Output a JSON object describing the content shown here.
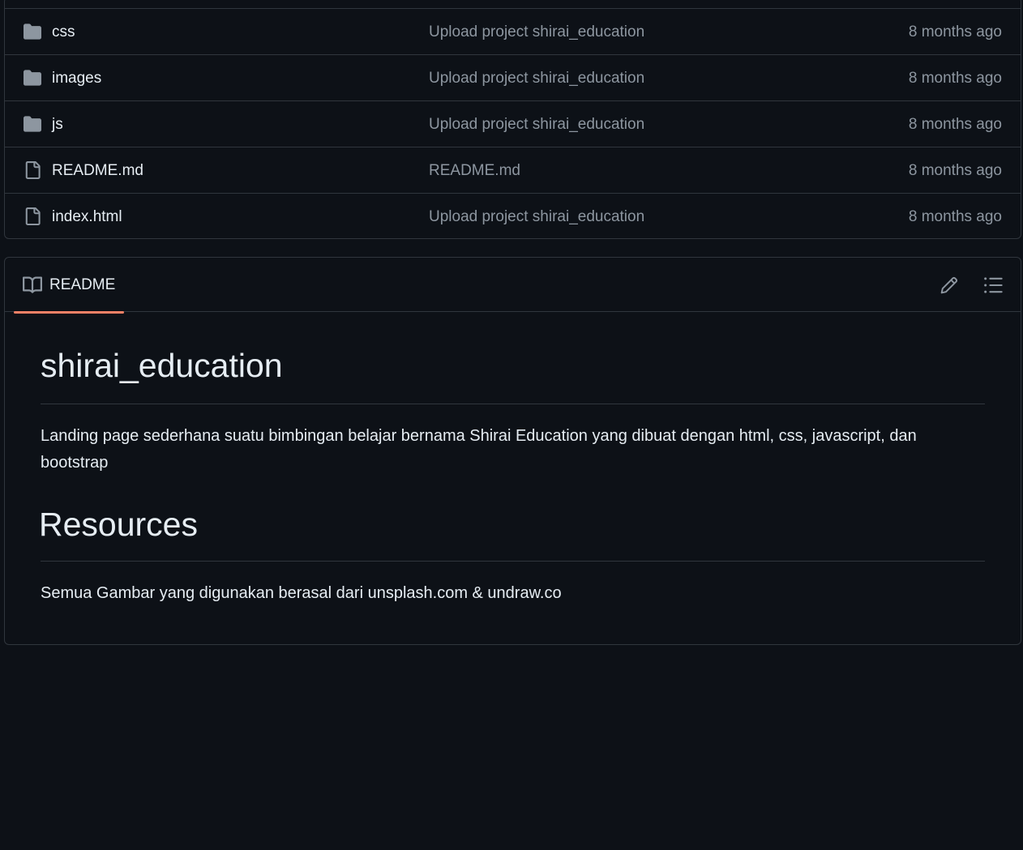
{
  "files": [
    {
      "type": "folder",
      "name": "css",
      "commit": "Upload project shirai_education",
      "time": "8 months ago"
    },
    {
      "type": "folder",
      "name": "images",
      "commit": "Upload project shirai_education",
      "time": "8 months ago"
    },
    {
      "type": "folder",
      "name": "js",
      "commit": "Upload project shirai_education",
      "time": "8 months ago"
    },
    {
      "type": "file",
      "name": "README.md",
      "commit": "README.md",
      "time": "8 months ago"
    },
    {
      "type": "file",
      "name": "index.html",
      "commit": "Upload project shirai_education",
      "time": "8 months ago"
    }
  ],
  "readme": {
    "tab_label": "README",
    "tab_icon": "book-icon",
    "edit_icon": "pencil-icon",
    "outline_icon": "list-icon",
    "title": "shirai_education",
    "description": "Landing page sederhana suatu bimbingan belajar bernama Shirai Education yang dibuat dengan html, css, javascript, dan bootstrap",
    "resources_heading": "Resources",
    "resources_text": "Semua Gambar yang digunakan berasal dari unsplash.com & undraw.co"
  },
  "colors": {
    "background": "#0d1117",
    "border": "#30363d",
    "text": "#e6edf3",
    "muted": "#8d96a0",
    "tab_accent": "#f78166"
  }
}
